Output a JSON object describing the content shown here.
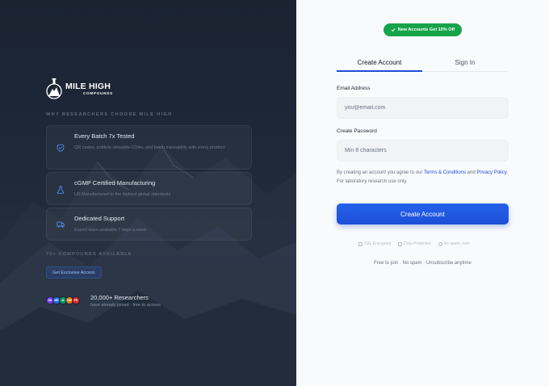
{
  "left": {
    "brand": {
      "name": "MILE HIGH",
      "sub": "COMPOUNDS",
      "logo_icon": "mountain-logo-icon"
    },
    "why_label": "WHY RESEARCHERS CHOOSE MILE HIGH",
    "features": [
      {
        "icon": "shield-check-icon",
        "title": "Every Batch 7x Tested",
        "desc": "QR codes, publicly viewable COAs, and batch traceability with every product"
      },
      {
        "icon": "flask-icon",
        "title": "cGMP Certified Manufacturing",
        "desc": "US Manufactured to the highest global standards"
      },
      {
        "icon": "truck-icon",
        "title": "Dedicated Support",
        "desc": "Expert team available 7 days a week"
      }
    ],
    "count_label": "70+ COMPOUNDS AVAILABLE",
    "exclusive_button": "Get Exclusive Access",
    "avatars": [
      {
        "initials": "SK",
        "color": "#7c3aed"
      },
      {
        "initials": "MR",
        "color": "#2563eb"
      },
      {
        "initials": "JL",
        "color": "#059669"
      },
      {
        "initials": "DW",
        "color": "#d97706"
      },
      {
        "initials": "PK",
        "color": "#dc2626"
      }
    ],
    "researchers_title": "20,000+ Researchers",
    "researchers_sub": "have already joined · free to access"
  },
  "right": {
    "promo": {
      "icon": "check-icon",
      "text": "New Accounts Get 10% Off"
    },
    "tabs": {
      "create": "Create Account",
      "signin": "Sign In"
    },
    "email": {
      "label": "Email Address",
      "placeholder": "you@email.com",
      "value": ""
    },
    "password": {
      "label": "Create Password",
      "placeholder": "Min 8 characters",
      "value": ""
    },
    "terms": {
      "prefix": "By creating an account you agree to our ",
      "link1": "Terms & Conditions",
      "middle": " and ",
      "link2": "Privacy Policy",
      "suffix": ". For laboratory research use only."
    },
    "submit": "Create Account",
    "badges": [
      {
        "icon": "lock-icon",
        "text": "SSL Encrypted"
      },
      {
        "icon": "shield-icon",
        "text": "Data Protected"
      },
      {
        "icon": "no-spam-icon",
        "text": "No spam, ever"
      }
    ],
    "tagline": "Free to join · No spam · Unsubscribe anytime"
  },
  "colors": {
    "accent": "#1d4ed8",
    "promo": "#16a34a",
    "left_bg": "#1e2838"
  }
}
